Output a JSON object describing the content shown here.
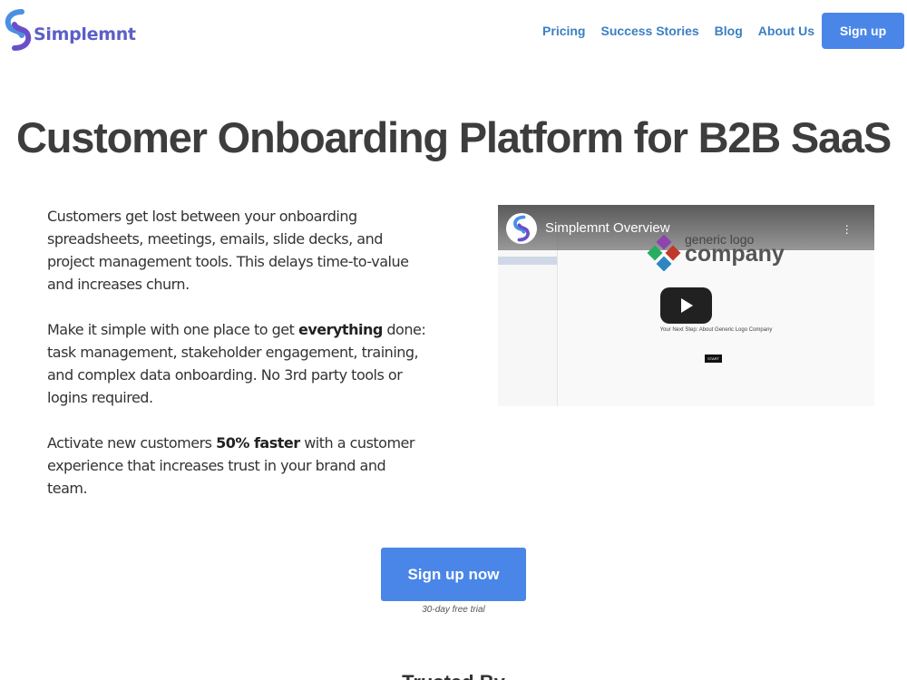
{
  "brand": {
    "name": "Simplemnt"
  },
  "nav": {
    "items": [
      "Pricing",
      "Success Stories",
      "Blog",
      "About Us"
    ],
    "signup_label": "Sign up"
  },
  "hero": {
    "title": "Customer Onboarding Platform for B2B SaaS"
  },
  "copy": {
    "p1": "Customers get lost between your onboarding spreadsheets, meetings, emails, slide decks, and project management tools. This delays time-to-value and increases churn.",
    "p2_before": "Make it simple with one place to get ",
    "p2_bold": "everything",
    "p2_after": " done: task management, stakeholder engagement, training, and complex data onboarding. No 3rd party tools or logins required.",
    "p3_before": "Activate new customers ",
    "p3_bold": "50% faster",
    "p3_after": " with a customer experience that increases trust in your brand and team."
  },
  "video": {
    "title": "Simplemnt Overview",
    "logo_line1": "generic logo",
    "logo_line2": "company",
    "next_step": "Your Next Step: About Generic Logo Company",
    "start_label": "START"
  },
  "cta": {
    "label": "Sign up now",
    "note": "30-day free trial"
  },
  "next_section": {
    "heading": "Trusted By"
  },
  "colors": {
    "accent": "#4a86e8",
    "nav_link": "#3b7fc4",
    "brand": "#5b5fc7"
  }
}
